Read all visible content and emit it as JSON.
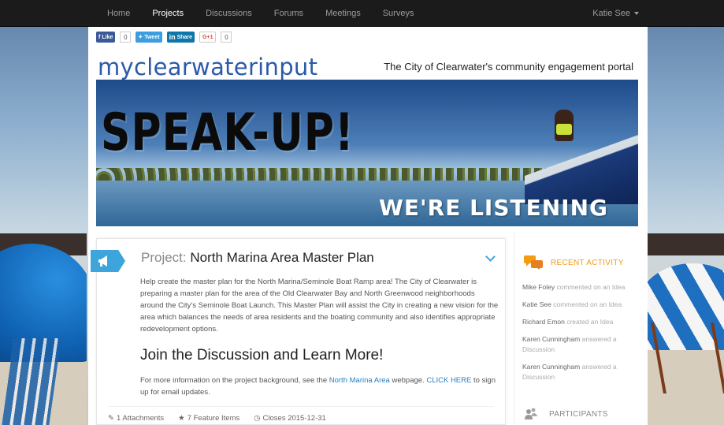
{
  "nav": {
    "items": [
      "Home",
      "Projects",
      "Discussions",
      "Forums",
      "Meetings",
      "Surveys"
    ],
    "active": "Projects",
    "user": "Katie See"
  },
  "social": {
    "facebook": {
      "label": "Like",
      "count": "0"
    },
    "twitter": {
      "label": "Tweet"
    },
    "linkedin": {
      "label": "Share"
    },
    "googleplus": {
      "label": "G+1",
      "count": "0"
    }
  },
  "header": {
    "brand": "myclearwaterinput",
    "tagline": "The City of Clearwater's community engagement portal"
  },
  "hero": {
    "title": "SPEAK-UP!",
    "subtitle": "WE'RE LISTENING"
  },
  "project": {
    "label": "Project:",
    "name": "North Marina Area Master Plan",
    "description": "Help create the master plan for the North Marina/Seminole Boat Ramp area! The City of Clearwater is preparing a master plan for the area of the Old Clearwater Bay and North Greenwood neighborhoods around the City's Seminole Boat Launch. This Master Plan will assist the City in creating a new vision for the area which balances the needs of area residents and the boating community and also identifies appropriate redevelopment options.",
    "heading": "Join the Discussion and Learn More!",
    "more_prefix": "For more information on the project background, see the ",
    "more_link": "North Marina Area",
    "more_mid": " webpage. ",
    "more_cta": "CLICK HERE",
    "more_suffix": " to sign up for email updates.",
    "footer": {
      "attachments": "1 Attachments",
      "features": "7 Feature Items",
      "closes": "Closes 2015-12-31"
    }
  },
  "sidebar": {
    "recent_title": "RECENT ACTIVITY",
    "activity": [
      {
        "who": "Mike Foley",
        "what": " commented on an Idea"
      },
      {
        "who": "Katie See",
        "what": " commented on an Idea"
      },
      {
        "who": "Richard Emon",
        "what": " created an Idea"
      },
      {
        "who": "Karen Cunningham",
        "what": " answered a Discussion"
      },
      {
        "who": "Karen Cunningham",
        "what": " answered a Discussion"
      }
    ],
    "participants_title": "PARTICIPANTS"
  },
  "colors": {
    "accent": "#3da5dc",
    "brand": "#2a5aa8",
    "activity": "#f39c12",
    "navbar": "#1b1b1b"
  }
}
